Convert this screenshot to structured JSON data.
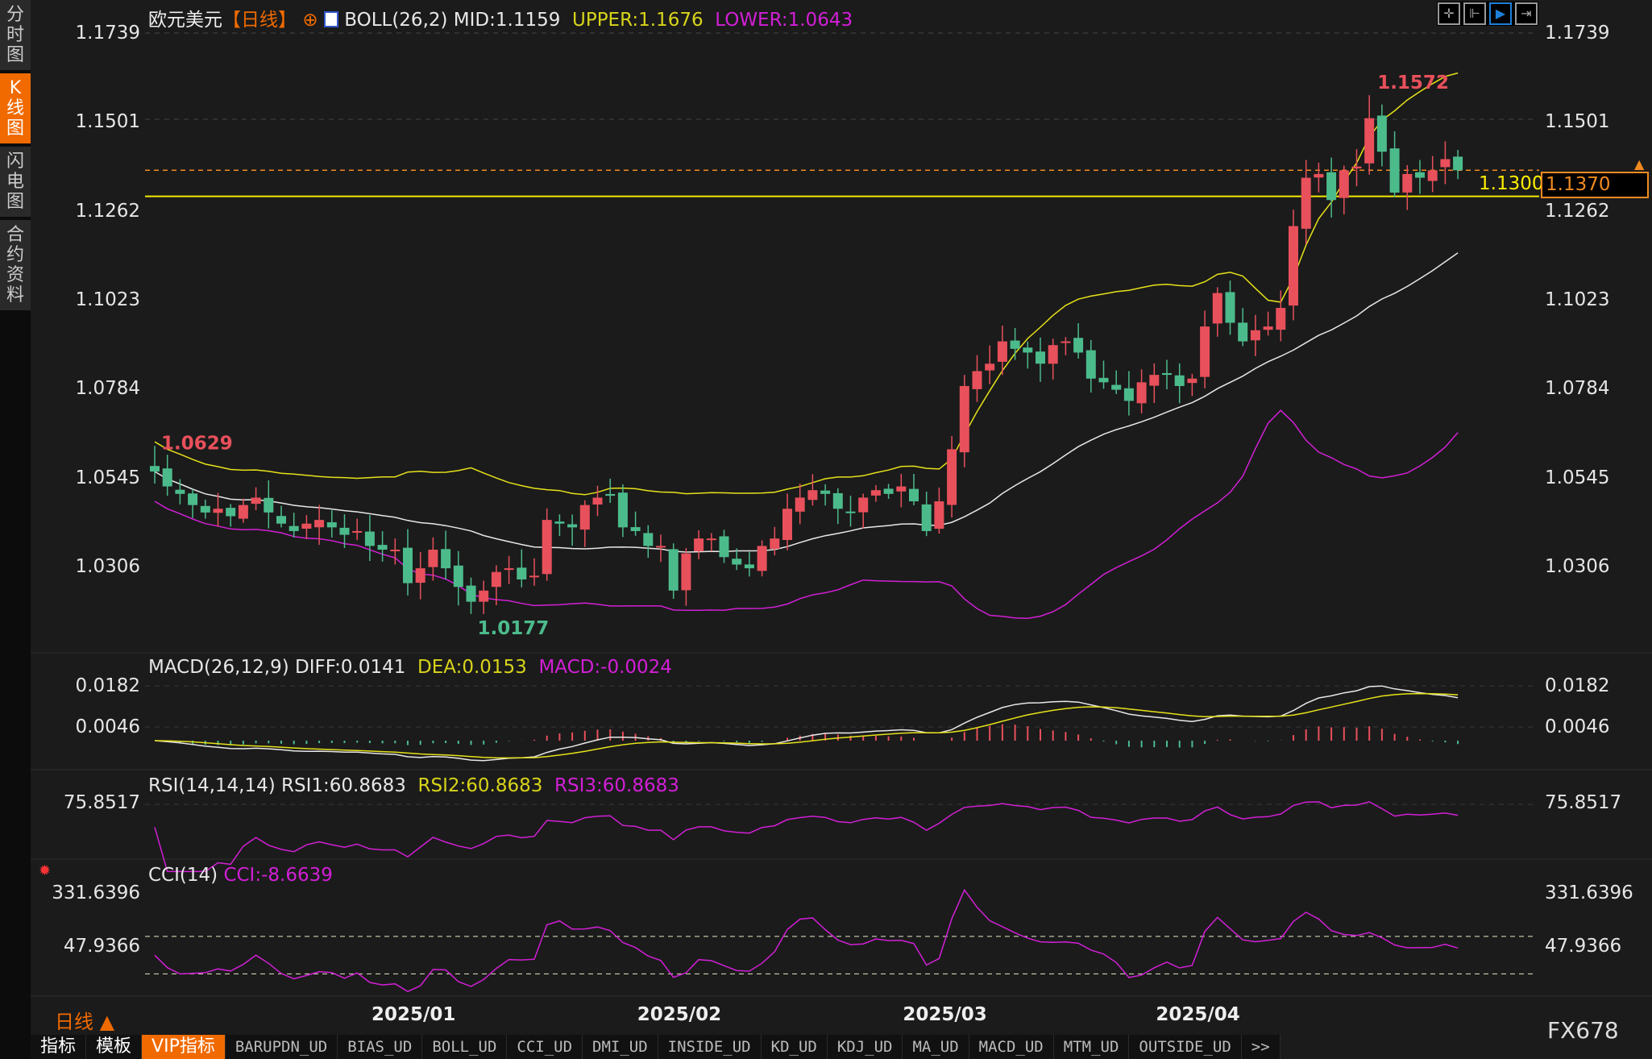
{
  "sidebar": [
    {
      "label": "分\n时\n图",
      "active": false
    },
    {
      "label": "K\n线\n图",
      "active": true
    },
    {
      "label": "闪\n电\n图",
      "active": false
    },
    {
      "label": "合\n约\n资\n料",
      "active": false
    }
  ],
  "header": {
    "symbol": "欧元美元",
    "period": "【日线】",
    "boll": "BOLL(26,2) MID:1.1159",
    "upper": "UPPER:1.1676",
    "lower": "LOWER:1.0643"
  },
  "toolbar": [
    "crosshair-icon",
    "range-left-icon",
    "auto-scroll-icon",
    "shift-right-icon"
  ],
  "price_axis": [
    "1.1739",
    "1.1501",
    "1.1262",
    "1.1023",
    "1.0784",
    "1.0545",
    "1.0306"
  ],
  "price_values": [
    1.1739,
    1.1501,
    1.1262,
    1.1023,
    1.0784,
    1.0545,
    1.0306
  ],
  "markers": {
    "high": "1.1572",
    "high_index": 96,
    "start_high": "1.0629",
    "low": "1.0177",
    "low_index": 25
  },
  "lines": {
    "current_price": "1.1370",
    "current_value": 1.137,
    "horizontal_label": "1.1300",
    "horizontal_value": 1.13
  },
  "macd": {
    "title": "MACD(26,12,9) DIFF:0.0141",
    "dea": "DEA:0.0153",
    "macd": "MACD:-0.0024",
    "axis": [
      "0.0182",
      "0.0046"
    ]
  },
  "rsi": {
    "title": "RSI(14,14,14) RSI1:60.8683",
    "rsi2": "RSI2:60.8683",
    "rsi3": "RSI3:60.8683",
    "axis": [
      "75.8517"
    ]
  },
  "cci": {
    "title": "CCI(14)",
    "value": "CCI:-8.6639",
    "axis": [
      "331.6396",
      "47.9366"
    ]
  },
  "dates": [
    {
      "label": "2025/01",
      "index": 20
    },
    {
      "label": "2025/02",
      "index": 41
    },
    {
      "label": "2025/03",
      "index": 62
    },
    {
      "label": "2025/04",
      "index": 82
    }
  ],
  "period_button": "日线 ▲",
  "watermark": "FX678",
  "tabs": [
    {
      "label": "指标",
      "cn": true
    },
    {
      "label": "模板",
      "cn": true
    },
    {
      "label": "VIP指标",
      "cn": true,
      "active": true
    },
    {
      "label": "BARUPDN_UD"
    },
    {
      "label": "BIAS_UD"
    },
    {
      "label": "BOLL_UD"
    },
    {
      "label": "CCI_UD"
    },
    {
      "label": "DMI_UD"
    },
    {
      "label": "INSIDE_UD"
    },
    {
      "label": "KD_UD"
    },
    {
      "label": "KDJ_UD"
    },
    {
      "label": "MA_UD"
    },
    {
      "label": "MACD_UD"
    },
    {
      "label": "MTM_UD"
    },
    {
      "label": "OUTSIDE_UD"
    },
    {
      "label": ">>"
    }
  ],
  "colors": {
    "up": "#e8505b",
    "down": "#4cbb8c",
    "mid": "#e8e8e8",
    "upper": "#e6e21a",
    "lower": "#d21fd6",
    "accent": "#f06a00"
  },
  "chart_data": {
    "type": "candlestick",
    "closes": [
      1.056,
      1.052,
      1.05,
      1.047,
      1.045,
      1.046,
      1.044,
      1.047,
      1.049,
      1.045,
      1.042,
      1.04,
      1.042,
      1.043,
      1.041,
      1.039,
      1.04,
      1.036,
      1.035,
      1.035,
      1.026,
      1.03,
      1.035,
      1.03,
      1.025,
      1.021,
      1.024,
      1.029,
      1.03,
      1.027,
      1.028,
      1.043,
      1.042,
      1.041,
      1.047,
      1.049,
      1.0495,
      1.041,
      1.04,
      1.036,
      1.036,
      1.024,
      1.034,
      1.038,
      1.038,
      1.033,
      1.031,
      1.03,
      1.036,
      1.038,
      1.046,
      1.049,
      1.051,
      1.05,
      1.046,
      1.045,
      1.049,
      1.051,
      1.05,
      1.052,
      1.048,
      1.04,
      1.048,
      1.062,
      1.079,
      1.083,
      1.085,
      1.091,
      1.089,
      1.088,
      1.085,
      1.09,
      1.091,
      1.088,
      1.081,
      1.08,
      1.078,
      1.075,
      1.08,
      1.082,
      1.082,
      1.079,
      1.081,
      1.095,
      1.104,
      1.096,
      1.091,
      1.094,
      1.095,
      1.1,
      1.122,
      1.135,
      1.136,
      1.129,
      1.137,
      1.138,
      1.151,
      1.142,
      1.131,
      1.136,
      1.135,
      1.137,
      1.14,
      1.137
    ],
    "open_first": 1.0575,
    "ylim": [
      1.0177,
      1.1739
    ]
  }
}
